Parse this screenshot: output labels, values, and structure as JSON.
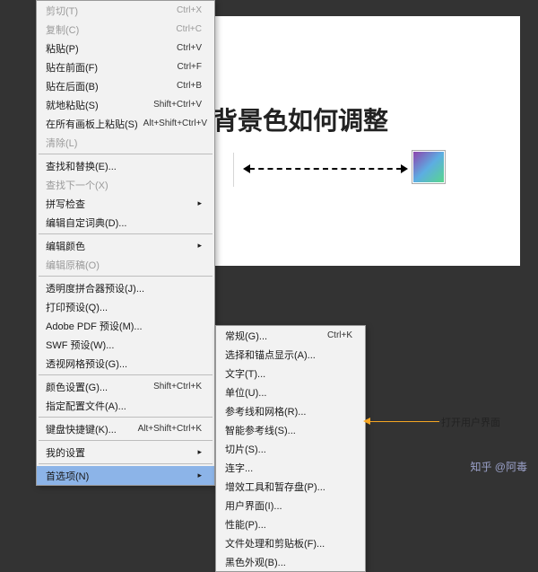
{
  "canvas": {
    "title": "背景色如何调整"
  },
  "menu_main": [
    {
      "label": "剪切(T)",
      "shortcut": "Ctrl+X",
      "disabled": true
    },
    {
      "label": "复制(C)",
      "shortcut": "Ctrl+C",
      "disabled": true
    },
    {
      "label": "粘贴(P)",
      "shortcut": "Ctrl+V"
    },
    {
      "label": "贴在前面(F)",
      "shortcut": "Ctrl+F"
    },
    {
      "label": "贴在后面(B)",
      "shortcut": "Ctrl+B"
    },
    {
      "label": "就地粘贴(S)",
      "shortcut": "Shift+Ctrl+V"
    },
    {
      "label": "在所有画板上粘贴(S)",
      "shortcut": "Alt+Shift+Ctrl+V"
    },
    {
      "label": "清除(L)",
      "shortcut": "",
      "disabled": true
    },
    {
      "type": "sep"
    },
    {
      "label": "查找和替换(E)...",
      "shortcut": ""
    },
    {
      "label": "查找下一个(X)",
      "shortcut": "",
      "disabled": true
    },
    {
      "label": "拼写检查",
      "shortcut": "",
      "submenu": true
    },
    {
      "label": "编辑自定词典(D)...",
      "shortcut": ""
    },
    {
      "type": "sep"
    },
    {
      "label": "编辑颜色",
      "shortcut": "",
      "submenu": true
    },
    {
      "label": "编辑原稿(O)",
      "shortcut": "",
      "disabled": true
    },
    {
      "type": "sep"
    },
    {
      "label": "透明度拼合器预设(J)...",
      "shortcut": ""
    },
    {
      "label": "打印预设(Q)...",
      "shortcut": ""
    },
    {
      "label": "Adobe PDF 预设(M)...",
      "shortcut": ""
    },
    {
      "label": "SWF 预设(W)...",
      "shortcut": ""
    },
    {
      "label": "透视网格预设(G)...",
      "shortcut": ""
    },
    {
      "type": "sep"
    },
    {
      "label": "颜色设置(G)...",
      "shortcut": "Shift+Ctrl+K"
    },
    {
      "label": "指定配置文件(A)...",
      "shortcut": ""
    },
    {
      "type": "sep"
    },
    {
      "label": "键盘快捷键(K)...",
      "shortcut": "Alt+Shift+Ctrl+K"
    },
    {
      "type": "sep"
    },
    {
      "label": "我的设置",
      "shortcut": "",
      "submenu": true
    },
    {
      "type": "sep"
    },
    {
      "label": "首选项(N)",
      "shortcut": "",
      "submenu": true,
      "highlight": true
    }
  ],
  "menu_sub": [
    {
      "label": "常规(G)...",
      "shortcut": "Ctrl+K"
    },
    {
      "label": "选择和锚点显示(A)...",
      "shortcut": ""
    },
    {
      "label": "文字(T)...",
      "shortcut": ""
    },
    {
      "label": "单位(U)...",
      "shortcut": ""
    },
    {
      "label": "参考线和网格(R)...",
      "shortcut": ""
    },
    {
      "label": "智能参考线(S)...",
      "shortcut": ""
    },
    {
      "label": "切片(S)...",
      "shortcut": ""
    },
    {
      "label": "连字...",
      "shortcut": ""
    },
    {
      "label": "增效工具和暂存盘(P)...",
      "shortcut": ""
    },
    {
      "label": "用户界面(I)...",
      "shortcut": ""
    },
    {
      "label": "性能(P)...",
      "shortcut": ""
    },
    {
      "label": "文件处理和剪贴板(F)...",
      "shortcut": ""
    },
    {
      "label": "黑色外观(B)...",
      "shortcut": ""
    }
  ],
  "annotation": {
    "label": "打开用户界面"
  },
  "watermark": {
    "text": "知乎 @阿毒"
  }
}
